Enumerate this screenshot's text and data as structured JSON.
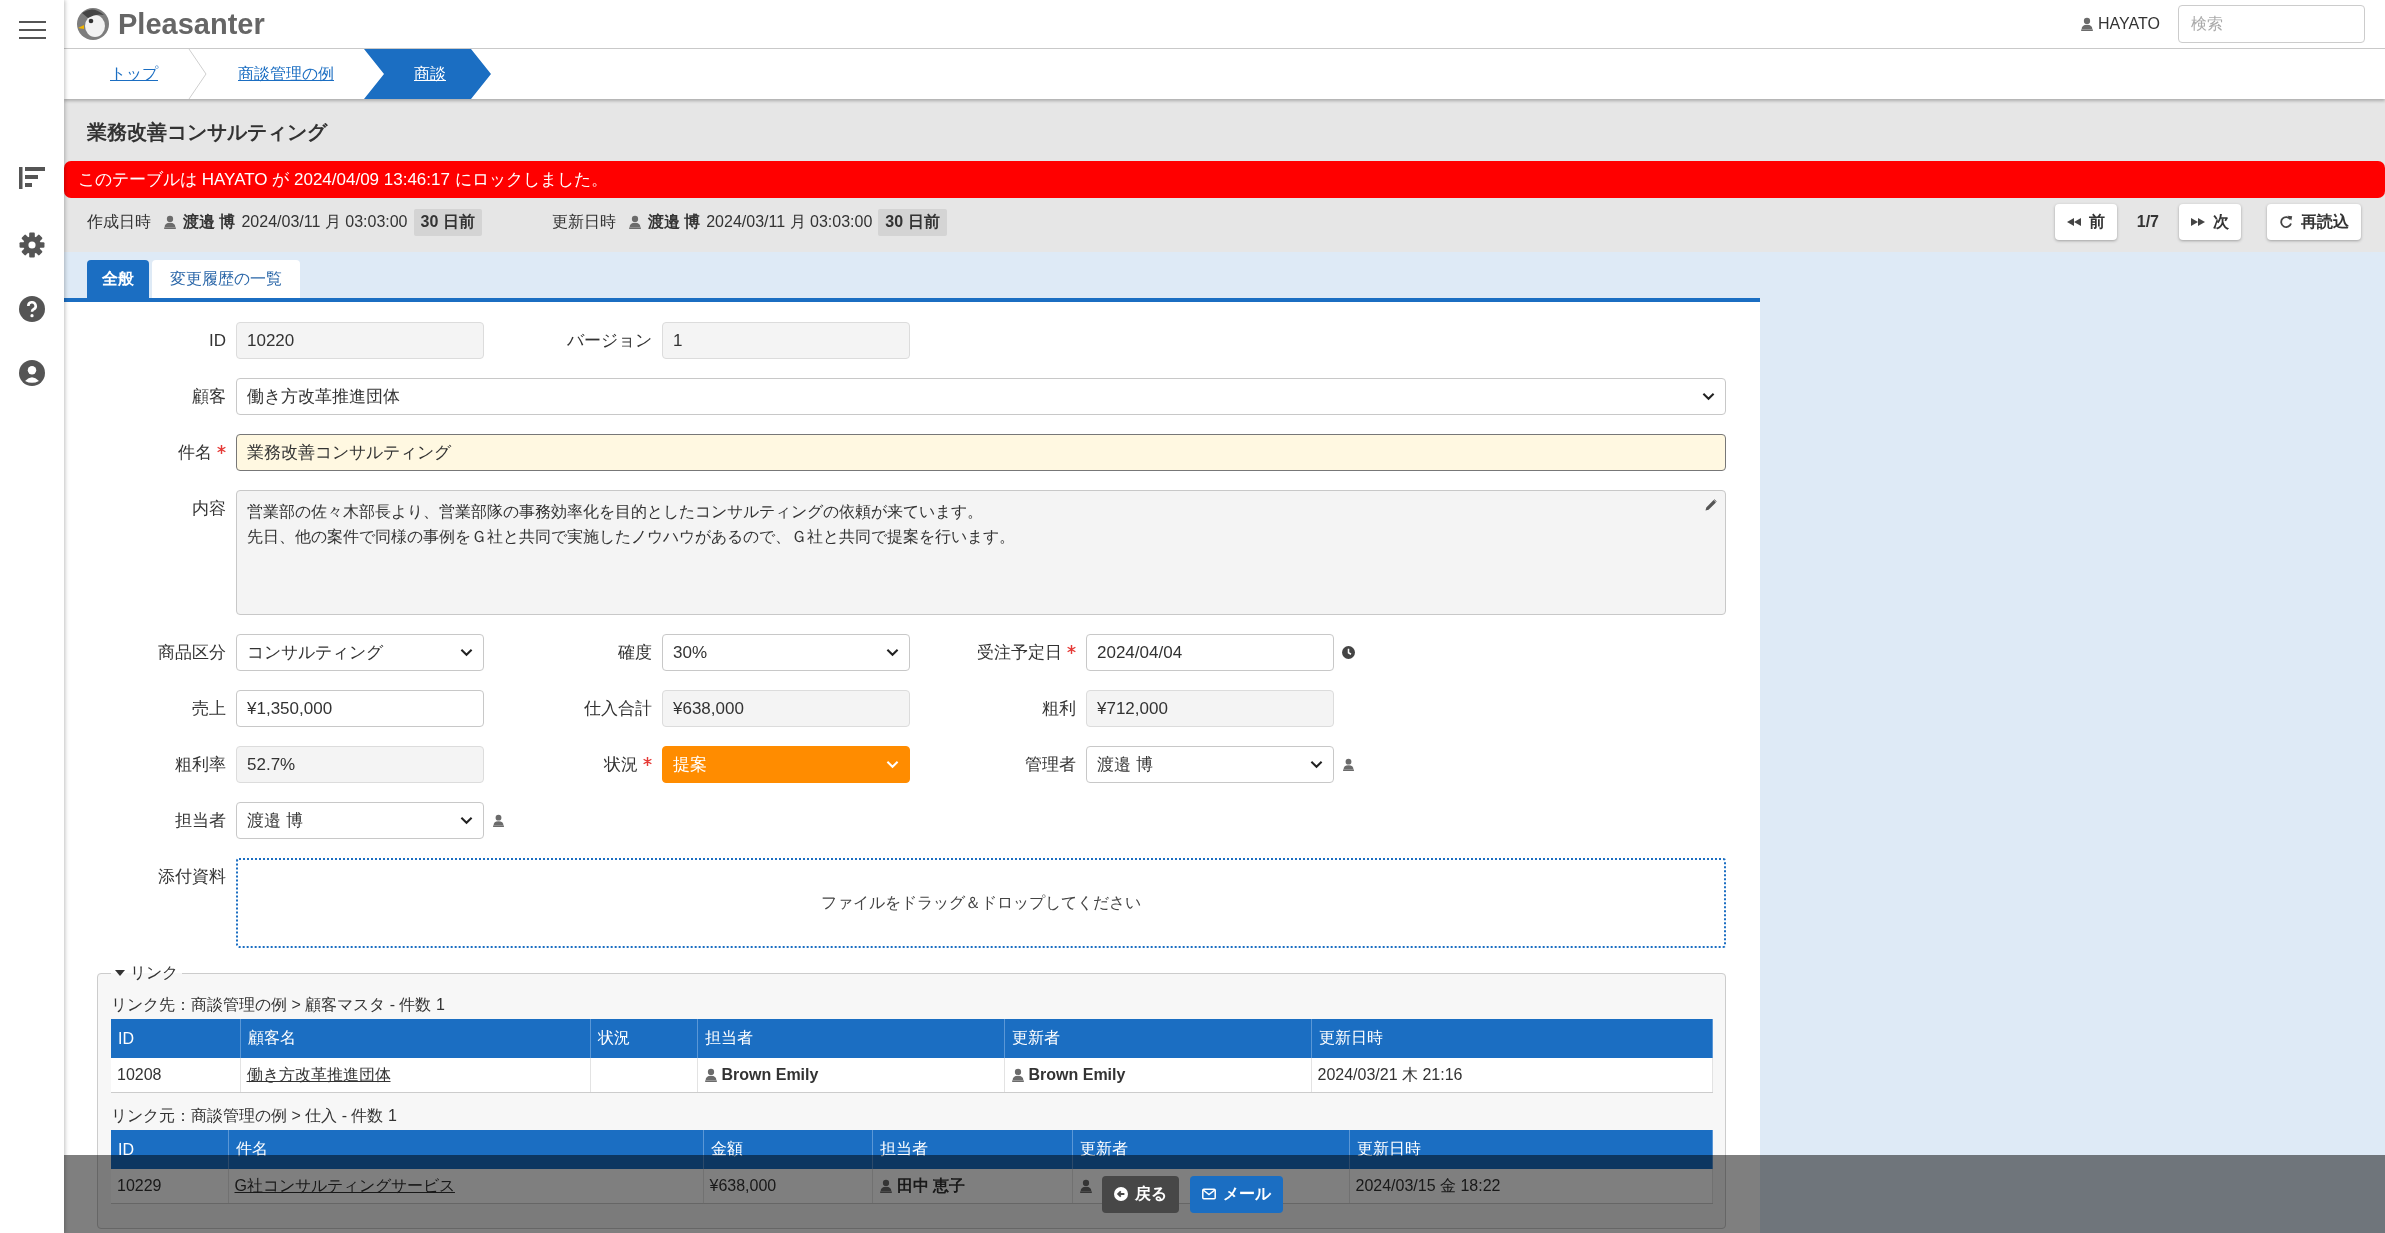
{
  "header": {
    "logo": "Pleasanter",
    "user": "HAYATO",
    "search": {
      "placeholder": "検索"
    }
  },
  "breadcrumbs": [
    {
      "label": "トップ",
      "selected": false
    },
    {
      "label": "商談管理の例",
      "selected": false
    },
    {
      "label": "商談",
      "selected": true
    }
  ],
  "title": "業務改善コンサルティング",
  "lock_message": "このテーブルは HAYATO が 2024/04/09 13:46:17 にロックしました。",
  "record_info": [
    {
      "label": "作成日時",
      "user": "渡邉 博",
      "datetime": "2024/03/11 月 03:03:00",
      "age": "30 日前"
    },
    {
      "label": "更新日時",
      "user": "渡邉 博",
      "datetime": "2024/03/11 月 03:03:00",
      "age": "30 日前"
    }
  ],
  "pager": {
    "previous": "前",
    "position": "1/7",
    "next": "次",
    "reload": "再読込"
  },
  "tabs": [
    {
      "label": "全般",
      "selected": true
    },
    {
      "label": "変更履歴の一覧",
      "selected": false
    }
  ],
  "form": {
    "header_fields": [
      {
        "label": "ID",
        "value": "10220",
        "kind": "readonly",
        "required": false
      },
      {
        "label": "バージョン",
        "value": "1",
        "kind": "readonly",
        "required": false
      }
    ],
    "wide_fields": [
      {
        "label": "顧客",
        "value": "働き方改革推進団体",
        "kind": "select",
        "required": false,
        "focused": false
      },
      {
        "label": "件名",
        "value": "業務改善コンサルティング",
        "kind": "text",
        "required": true,
        "focused": true
      },
      {
        "label": "内容",
        "lines": [
          "営業部の佐々木部長より、営業部隊の事務効率化を目的としたコンサルティングの依頼が来ています。",
          "先日、他の案件で同様の事例をＧ社と共同で実施したノウハウがあるので、Ｇ社と共同で提案を行います。"
        ],
        "kind": "textarea",
        "required": false,
        "focused": false
      }
    ],
    "grid_fields": [
      {
        "label": "商品区分",
        "value": "コンサルティング",
        "kind": "select",
        "required": false
      },
      {
        "label": "確度",
        "value": "30%",
        "kind": "select",
        "required": false
      },
      {
        "label": "受注予定日",
        "value": "2024/04/04",
        "kind": "date",
        "required": true
      },
      {
        "label": "売上",
        "value": "¥1,350,000",
        "kind": "text",
        "required": false
      },
      {
        "label": "仕入合計",
        "value": "¥638,000",
        "kind": "readonly",
        "required": false
      },
      {
        "label": "粗利",
        "value": "¥712,000",
        "kind": "readonly",
        "required": false
      },
      {
        "label": "粗利率",
        "value": "52.7%",
        "kind": "readonly",
        "required": false
      },
      {
        "label": "状況",
        "value": "提案",
        "kind": "select",
        "required": true,
        "color": "#ff8c00"
      },
      {
        "label": "管理者",
        "value": "渡邉 博",
        "kind": "user_select",
        "required": false
      },
      {
        "label": "担当者",
        "value": "渡邉 博",
        "kind": "user_select",
        "required": false
      }
    ],
    "attachments": {
      "label": "添付資料",
      "placeholder": "ファイルをドラッグ＆ドロップしてください"
    }
  },
  "links": {
    "title": "リンク",
    "expanded": true,
    "tables": [
      {
        "caption": "リンク先：商談管理の例 > 顧客マスタ - 件数 1",
        "columns": [
          "ID",
          "顧客名",
          "状況",
          "担当者",
          "更新者",
          "更新日時"
        ],
        "rows": [
          [
            {
              "kind": "text",
              "text": "10208"
            },
            {
              "kind": "link",
              "text": "働き方改革推進団体"
            },
            {
              "kind": "empty"
            },
            {
              "kind": "user",
              "text": "Brown Emily"
            },
            {
              "kind": "user",
              "text": "Brown Emily"
            },
            {
              "kind": "text",
              "text": "2024/03/21 木 21:16"
            }
          ]
        ]
      },
      {
        "caption": "リンク元：商談管理の例 > 仕入 - 件数 1",
        "columns": [
          "ID",
          "件名",
          "金額",
          "担当者",
          "更新者",
          "更新日時"
        ],
        "rows": [
          [
            {
              "kind": "text",
              "text": "10229"
            },
            {
              "kind": "link",
              "text": "G社コンサルティングサービス"
            },
            {
              "kind": "text",
              "text": "¥638,000"
            },
            {
              "kind": "user",
              "text": "田中 恵子"
            },
            {
              "kind": "user"
            },
            {
              "kind": "text",
              "text": "2024/03/15 金 18:22"
            }
          ]
        ]
      }
    ]
  },
  "footer_buttons": [
    {
      "label": "戻る",
      "kind": "back"
    },
    {
      "label": "メール",
      "kind": "mail"
    }
  ]
}
